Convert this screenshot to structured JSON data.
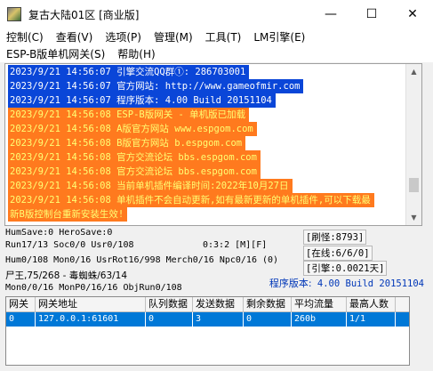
{
  "window": {
    "title": "复古大陆01区 [商业版]",
    "minimize_glyph": "—",
    "maximize_glyph": "☐",
    "close_glyph": "✕"
  },
  "menu": {
    "row1": [
      "控制(C)",
      "查看(V)",
      "选项(P)",
      "管理(M)",
      "工具(T)",
      "LM引擎(E)"
    ],
    "row2": [
      "ESP-B版单机网关(S)",
      "帮助(H)"
    ]
  },
  "log": {
    "lines": [
      {
        "text": "2023/9/21 14:56:07 引擎交流QQ群①: 286703001",
        "style": "blue"
      },
      {
        "text": "2023/9/21 14:56:07 官方网站: http://www.gameofmir.com",
        "style": "blue"
      },
      {
        "text": "2023/9/21 14:56:07 程序版本: 4.00 Build 20151104",
        "style": "blue"
      },
      {
        "text": "2023/9/21 14:56:08 ESP-B版网关 - 单机版已加载",
        "style": "orange"
      },
      {
        "text": "2023/9/21 14:56:08 A版官方网站 www.espgom.com",
        "style": "orange"
      },
      {
        "text": "2023/9/21 14:56:08 B版官方网站 b.espgom.com",
        "style": "orange"
      },
      {
        "text": "2023/9/21 14:56:08 官方交流论坛 bbs.espgom.com",
        "style": "orange"
      },
      {
        "text": "2023/9/21 14:56:08 官方交流论坛 bbs.espgom.com",
        "style": "orange"
      },
      {
        "text": "2023/9/21 14:56:08 当前单机插件编译时间:2022年10月27日",
        "style": "orange"
      },
      {
        "text": "2023/9/21 14:56:08 单机插件不会自动更新,如有最新更新的单机插件,可以下载最",
        "style": "orange"
      },
      {
        "text": "新B版控制台重新安装生效!",
        "style": "orange"
      }
    ]
  },
  "stats": {
    "line1": "HumSave:0 HeroSave:0",
    "line2": "Run17/13 Soc0/0 Usr0/108",
    "line2_mid": "0:3:2 [M][F]",
    "line3": "Hum0/108 Mon0/16 UsrRot16/998 Merch0/16 Npc0/16 (0)",
    "line4": "尸王,75/268 - 毒蜘蛛/63/14",
    "line5": "Mon0/0/16 MonP0/16/16 ObjRun0/108",
    "refresh": "[刷怪:8793]",
    "online": "[在线:6/6/0]",
    "engine": "[引擎:0.0021天]",
    "version_label": "程序版本:",
    "version_value": " 4.00 Build 20151104"
  },
  "gateway_table": {
    "columns": [
      "网关",
      "网关地址",
      "队列数据",
      "发送数据",
      "剩余数据",
      "平均流量",
      "最高人数"
    ],
    "rows": [
      [
        "0",
        "127.0.0.1:61601",
        "0",
        "3",
        "0",
        "260b",
        "1/1"
      ]
    ]
  },
  "colors": {
    "log_blue": "#0a46d8",
    "log_orange": "#ff7a1e",
    "log_orange_text": "#ffff73",
    "selection": "#0078d7",
    "version_text": "#0037b8"
  },
  "icons": {
    "app": "game-app-icon",
    "scroll_up": "scroll-up-arrow-icon",
    "scroll_down": "scroll-down-arrow-icon"
  }
}
